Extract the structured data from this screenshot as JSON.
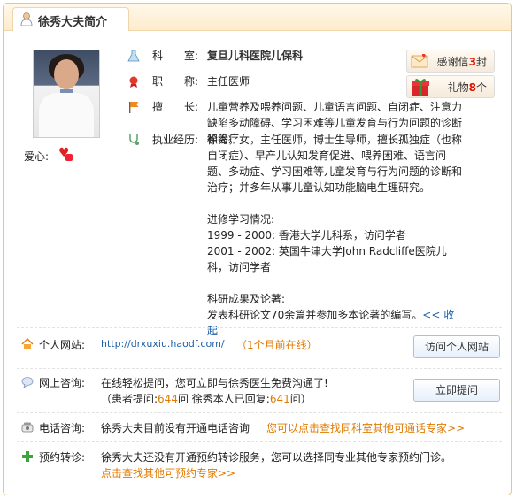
{
  "header": {
    "title": "徐秀大夫简介"
  },
  "profile": {
    "love_label": "爱心:",
    "department_label": "科　　室:",
    "department_value": "复旦儿科医院儿保科",
    "title_label": "职　　称:",
    "title_value": "主任医师",
    "specialty_label": "擅　　长:",
    "specialty_value": "儿童营养及喂养问题、儿童语言问题、自闭症、注意力缺陷多动障碍、学习困难等儿童发育与行为问题的诊断和治疗",
    "experience_label": "执业经历:",
    "experience_p1": "徐秀，女，主任医师，博士生导师，擅长孤独症（也称自闭症）、早产儿认知发育促进、喂养困难、语言问题、多动症、学习困难等儿童发育与行为问题的诊断和治疗；并多年从事儿童认知功能脑电生理研究。",
    "study_title": "进修学习情况:",
    "study_1": "1999 - 2000: 香港大学儿科系，访问学者",
    "study_2": "2001 - 2002: 英国牛津大学John Radcliffe医院儿科，访问学者",
    "research_title": "科研成果及论著:",
    "research_text": "发表科研论文70余篇并参加多本论著的编写。",
    "collapse_link": "<< 收起"
  },
  "badges": {
    "thanks_label": "感谢信",
    "thanks_count": "3",
    "thanks_unit": "封",
    "gift_label": "礼物",
    "gift_count": "8",
    "gift_unit": "个"
  },
  "website": {
    "label": "个人网站:",
    "url": "http://drxuxiu.haodf.com/",
    "status": "（1个月前在线）",
    "button": "访问个人网站"
  },
  "consult": {
    "label": "网上咨询:",
    "line1": "在线轻松提问，您可立即与徐秀医生免费沟通了!",
    "line2_prefix": "（患者提问:",
    "patient_count": "644",
    "line2_mid": "问  徐秀本人已回复:",
    "reply_count": "641",
    "line2_suffix": "问）",
    "button": "立即提问"
  },
  "phone": {
    "label": "电话咨询:",
    "text": "徐秀大夫目前没有开通电话咨询",
    "link": "您可以点击查找同科室其他可通话专家>>"
  },
  "appoint": {
    "label": "预约转诊:",
    "text": "徐秀大夫还没有开通预约转诊服务，您可以选择同专业其他专家预约门诊。",
    "link": "点击查找其他可预约专家>>"
  }
}
